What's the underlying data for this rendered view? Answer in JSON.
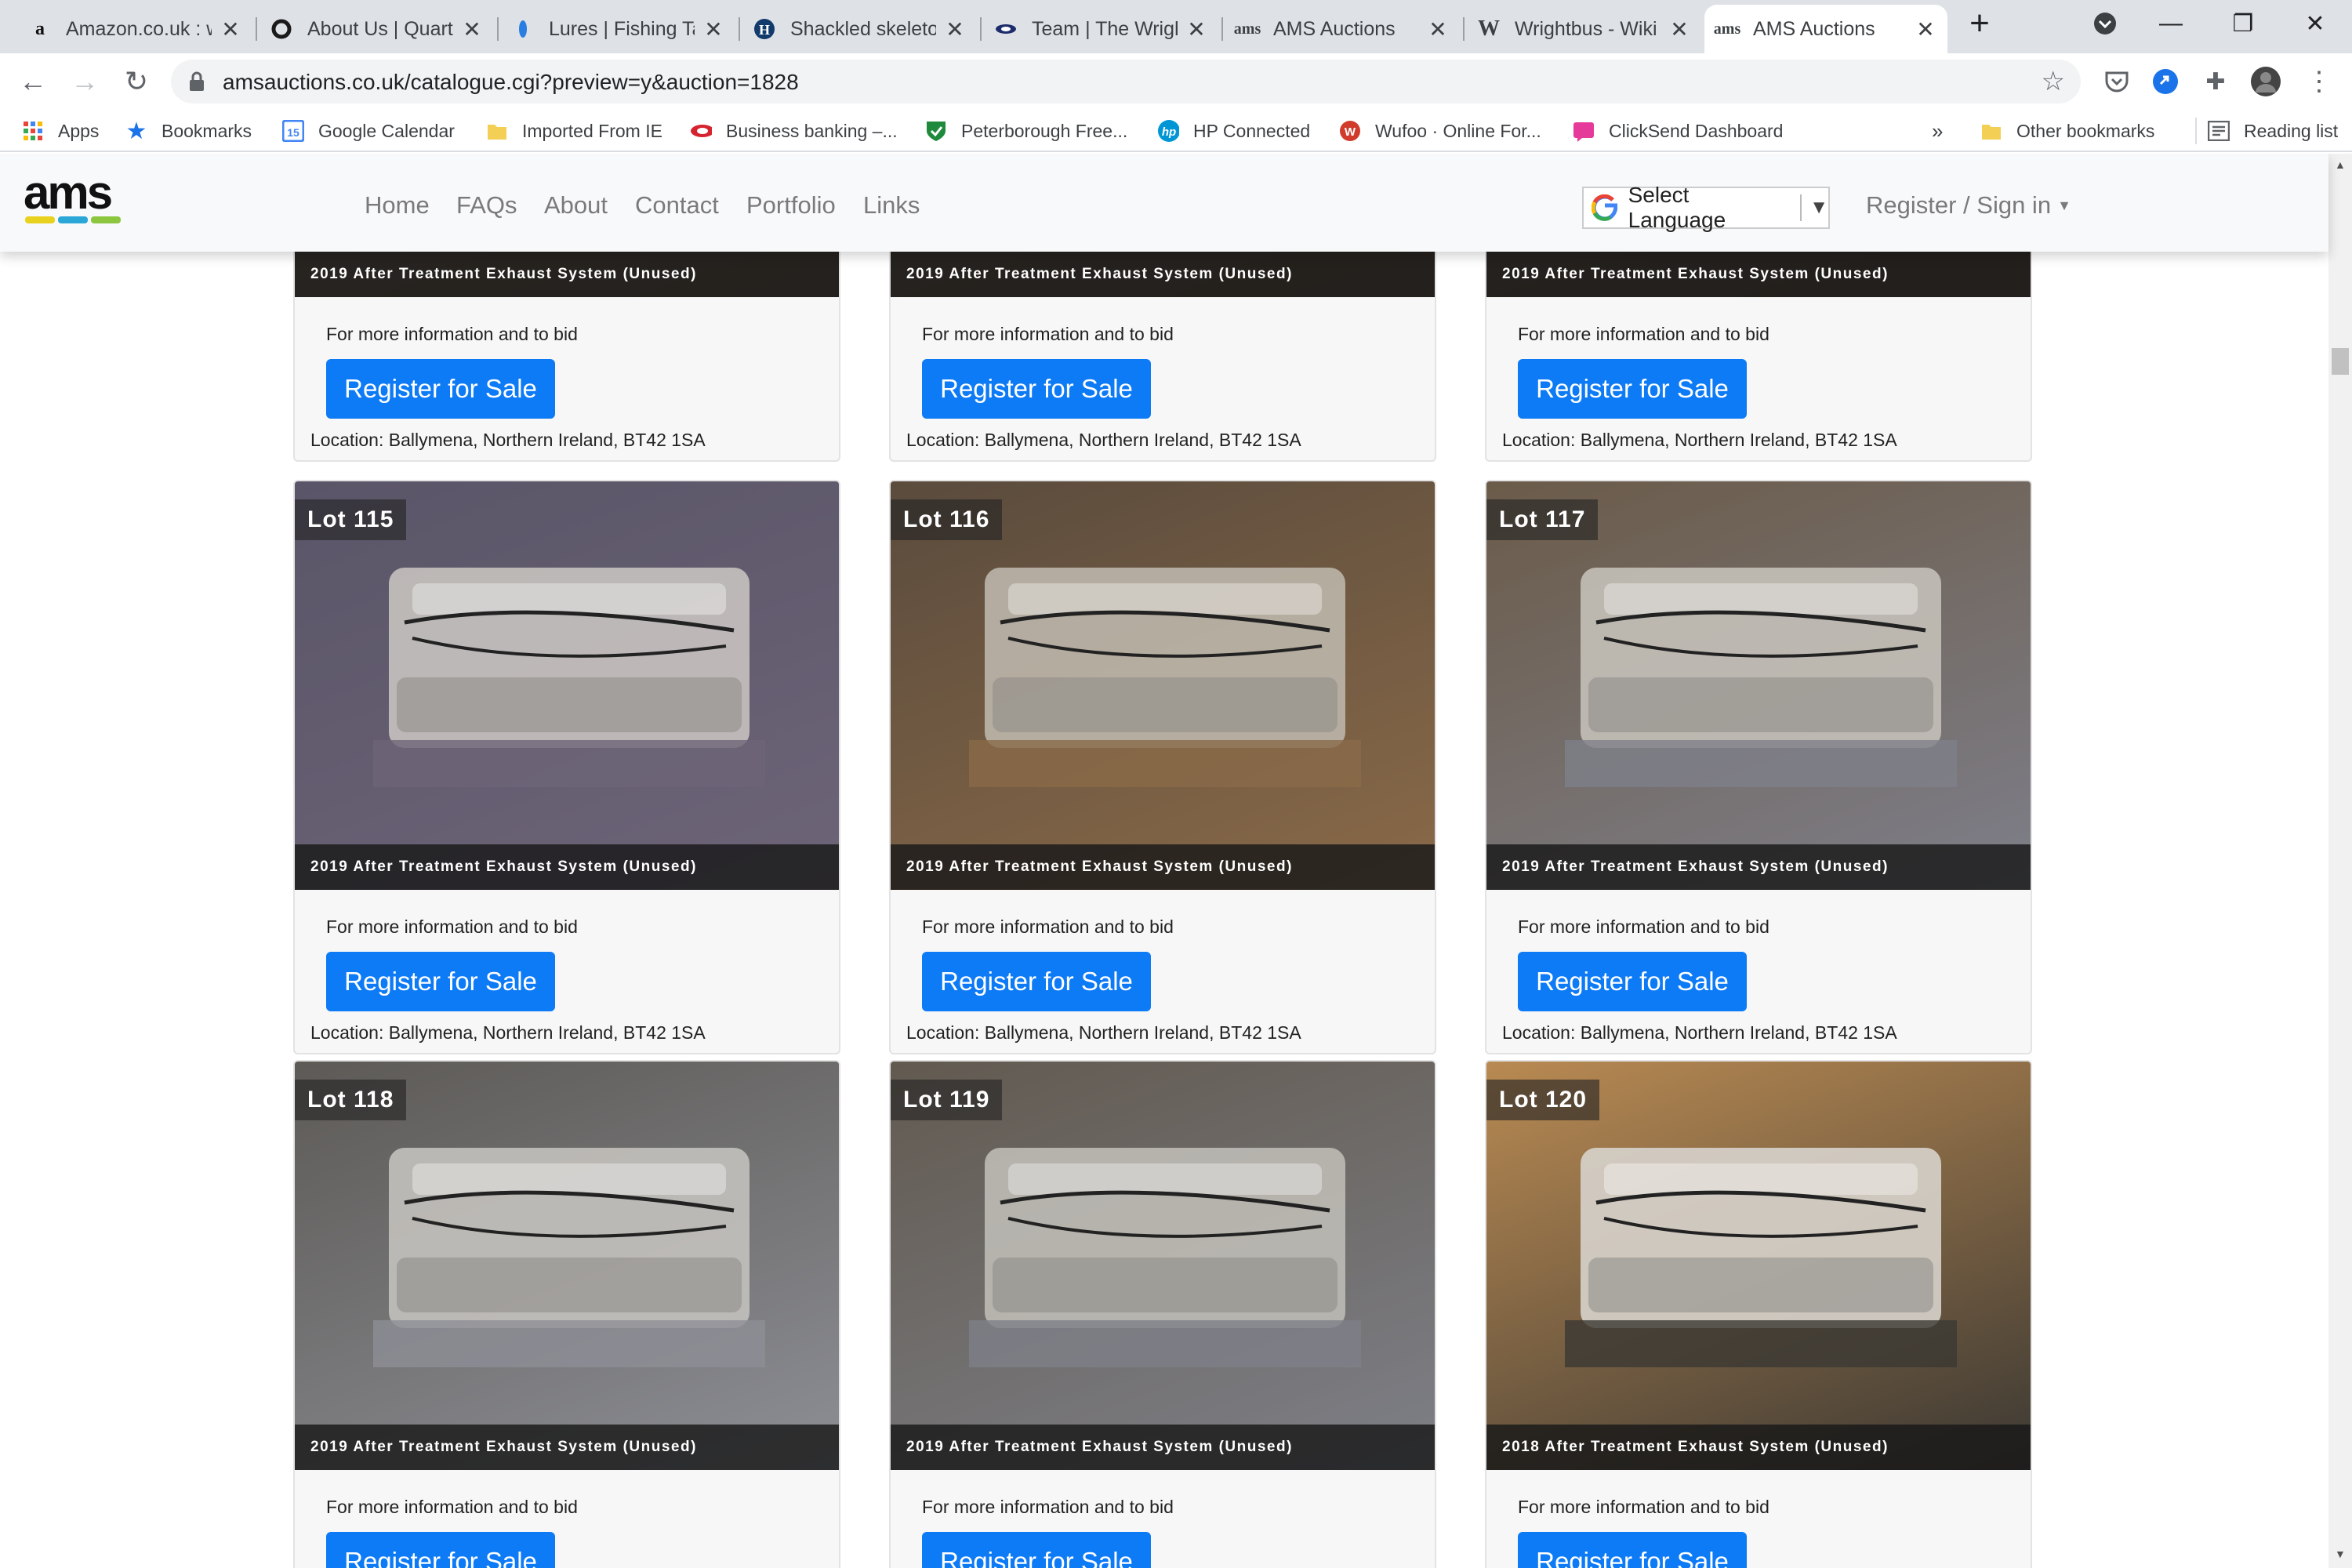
{
  "browser": {
    "tabs": [
      {
        "title": "Amazon.co.uk : w",
        "icon": "amazon-icon"
      },
      {
        "title": "About Us | Quart",
        "icon": "quartzy-icon"
      },
      {
        "title": "Lures | Fishing Ta",
        "icon": "lure-icon"
      },
      {
        "title": "Shackled skeleto",
        "icon": "history-icon"
      },
      {
        "title": "Team | The Wrigh",
        "icon": "wright-icon"
      },
      {
        "title": "AMS Auctions",
        "icon": "ams-icon"
      },
      {
        "title": "Wrightbus - Wiki",
        "icon": "wikipedia-icon"
      },
      {
        "title": "AMS Auctions",
        "icon": "ams-icon"
      }
    ],
    "active_tab": 7,
    "url": "amsauctions.co.uk/catalogue.cgi?preview=y&auction=1828",
    "bookmarks": [
      {
        "label": "Apps",
        "icon": "apps-grid-icon"
      },
      {
        "label": "Bookmarks",
        "icon": "star-icon"
      },
      {
        "label": "Google Calendar",
        "icon": "calendar-icon"
      },
      {
        "label": "Imported From IE",
        "icon": "folder-icon"
      },
      {
        "label": "Business banking –...",
        "icon": "bank-icon"
      },
      {
        "label": "Peterborough Free...",
        "icon": "shield-icon"
      },
      {
        "label": "HP Connected",
        "icon": "hp-icon"
      },
      {
        "label": "Wufoo · Online For...",
        "icon": "wufoo-icon"
      },
      {
        "label": "ClickSend Dashboard",
        "icon": "clicksend-icon"
      }
    ],
    "overflow_label": "»",
    "other_bookmarks": "Other bookmarks",
    "reading_list": "Reading list"
  },
  "site": {
    "logo_text": "ams",
    "nav": [
      "Home",
      "FAQs",
      "About",
      "Contact",
      "Portfolio",
      "Links"
    ],
    "language_select": "Select Language",
    "signin": "Register / Sign in"
  },
  "catalogue": {
    "info_text": "For more information and to bid",
    "button_label": "Register for Sale",
    "location": "Location: Ballymena, Northern Ireland, BT42 1SA",
    "lots": [
      {
        "lot": "",
        "caption": "2019 After Treatment Exhaust System (Unused)"
      },
      {
        "lot": "",
        "caption": "2019 After Treatment Exhaust System (Unused)"
      },
      {
        "lot": "",
        "caption": "2019 After Treatment Exhaust System (Unused)"
      },
      {
        "lot": "Lot 115",
        "caption": "2019 After Treatment Exhaust System (Unused)"
      },
      {
        "lot": "Lot 116",
        "caption": "2019 After Treatment Exhaust System (Unused)"
      },
      {
        "lot": "Lot 117",
        "caption": "2019 After Treatment Exhaust System (Unused)"
      },
      {
        "lot": "Lot 118",
        "caption": "2019 After Treatment Exhaust System (Unused)"
      },
      {
        "lot": "Lot 119",
        "caption": "2019 After Treatment Exhaust System (Unused)"
      },
      {
        "lot": "Lot 120",
        "caption": "2018 After Treatment Exhaust System (Unused)"
      }
    ]
  },
  "colors": {
    "primary_button": "#0d7af6",
    "logo_yellow": "#e8d21d",
    "logo_blue": "#2aa7d7",
    "logo_green": "#8cc63f"
  }
}
